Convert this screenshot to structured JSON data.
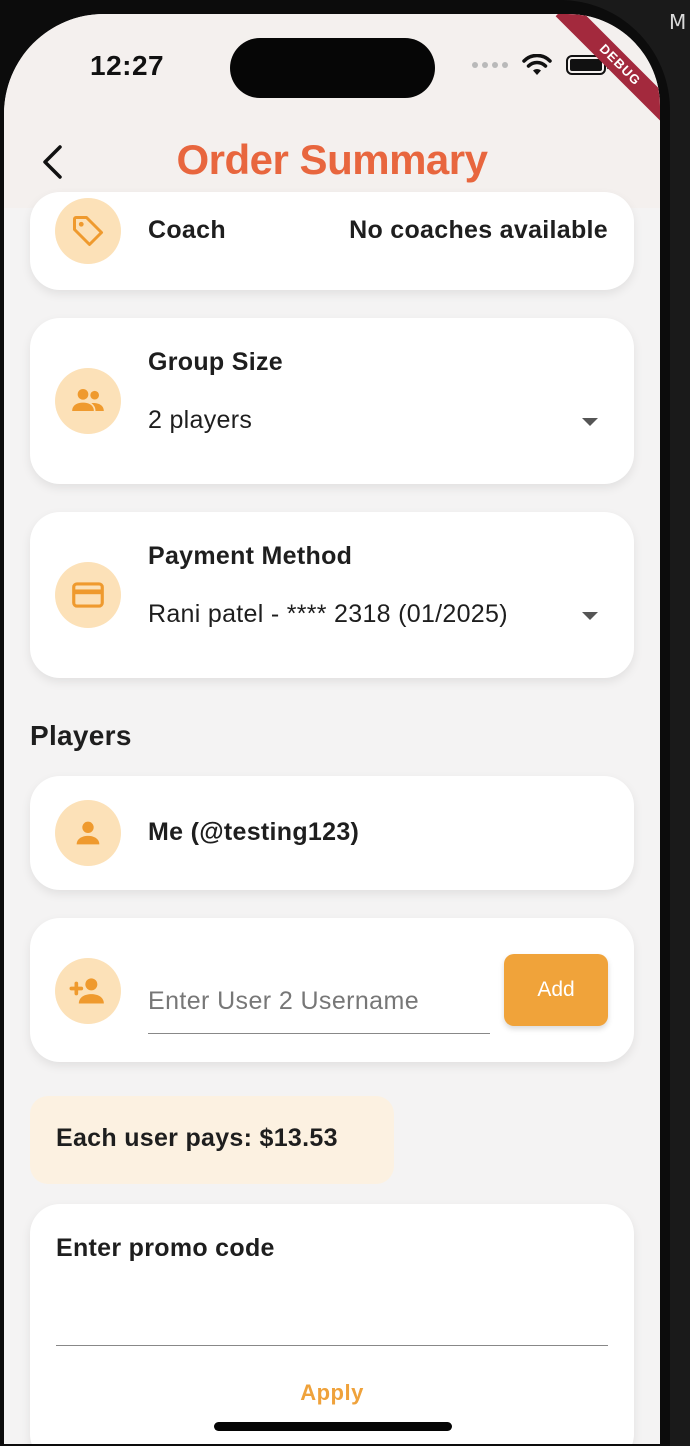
{
  "status_bar": {
    "time": "12:27"
  },
  "debug_ribbon": "DEBUG",
  "outside_char": "M",
  "header": {
    "title": "Order Summary"
  },
  "coach": {
    "label": "Coach",
    "value": "No coaches available"
  },
  "group_size": {
    "label": "Group Size",
    "value": "2 players"
  },
  "payment_method": {
    "label": "Payment Method",
    "value": "Rani patel - **** 2318 (01/2025)"
  },
  "players": {
    "heading": "Players",
    "me": "Me (@testing123)",
    "add_user_placeholder": "Enter User 2 Username",
    "add_button": "Add"
  },
  "each_user_pays": "Each user pays: $13.53",
  "promo": {
    "label": "Enter promo code",
    "apply_button": "Apply"
  },
  "colors": {
    "accent": "#e8663e",
    "button": "#f0a33a",
    "icon_bg": "#fce1b8",
    "icon_fg": "#ef9a2e"
  }
}
